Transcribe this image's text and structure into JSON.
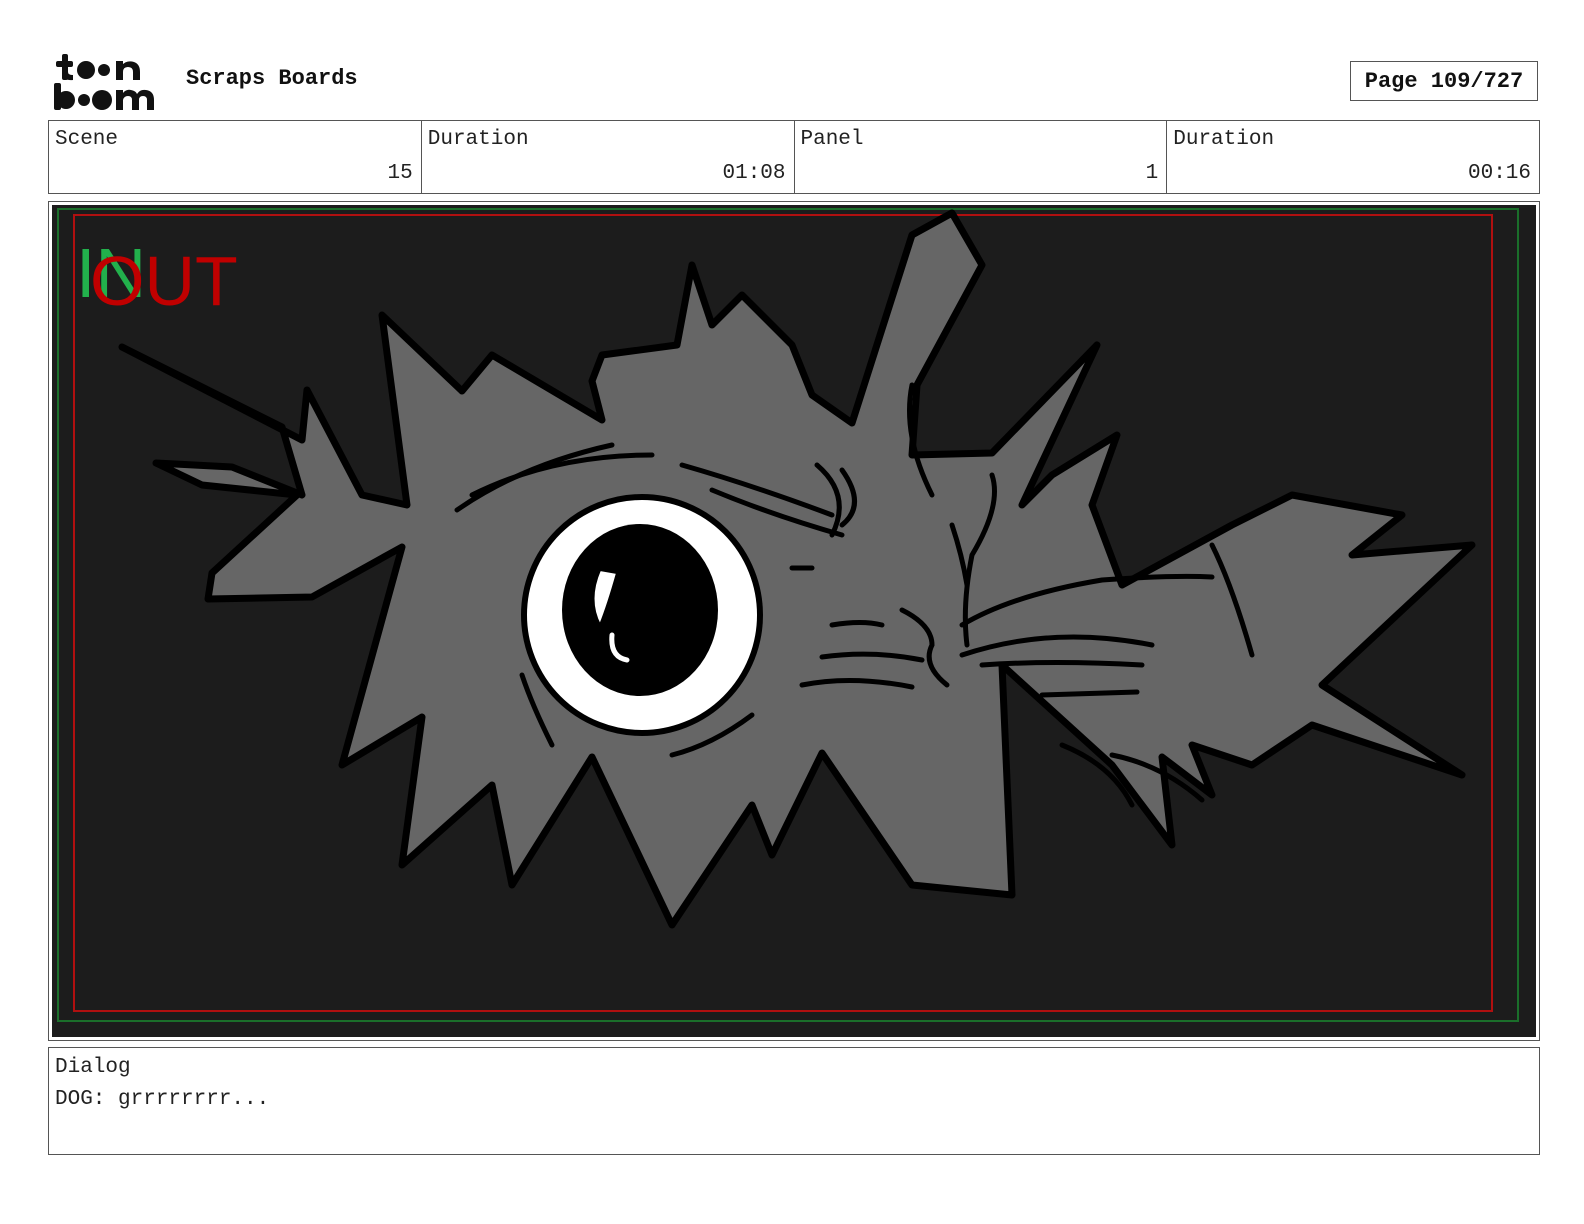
{
  "header": {
    "logo_text": "toonboom",
    "title": "Scraps Boards",
    "page_label": "Page 109/727"
  },
  "info": {
    "scene_label": "Scene",
    "scene_value": "15",
    "scene_duration_label": "Duration",
    "scene_duration_value": "01:08",
    "panel_label": "Panel",
    "panel_value": "1",
    "panel_duration_label": "Duration",
    "panel_duration_value": "00:16"
  },
  "panel": {
    "in_marker": "IN",
    "out_marker": "OUT",
    "background_color": "#1c1c1c",
    "fur_color": "#666666",
    "in_color": "#22b14c",
    "out_color": "#c00000"
  },
  "dialog": {
    "label": "Dialog",
    "text": "DOG: grrrrrrrr..."
  }
}
